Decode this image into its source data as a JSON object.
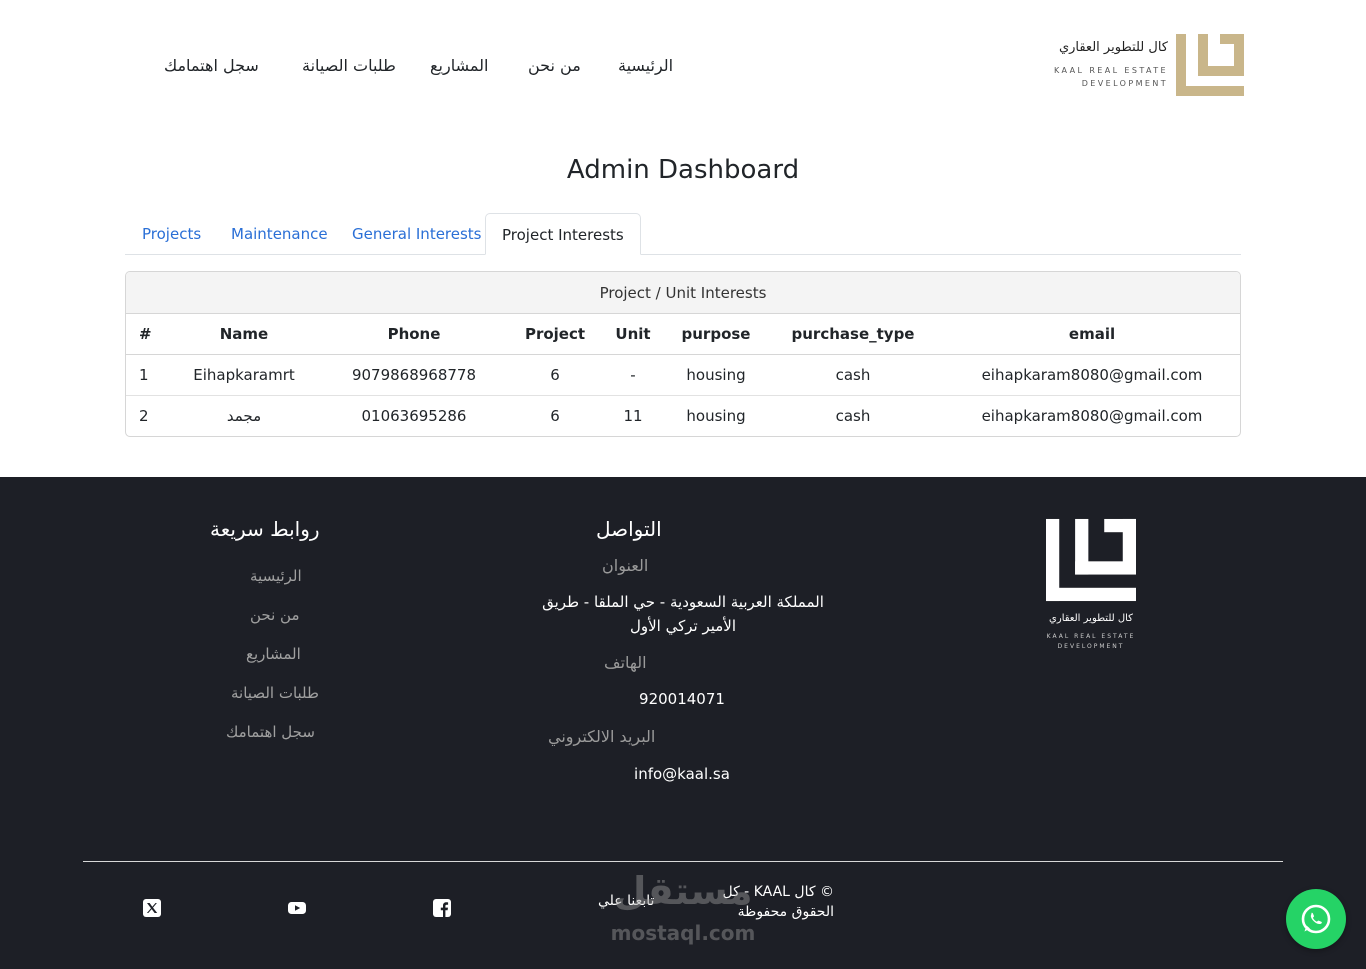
{
  "brand": {
    "name_ar": "كال للتطوير العقاري",
    "name_en_line1": "KAAL REAL ESTATE",
    "name_en_line2": "DEVELOPMENT",
    "gold": "#c9b68a"
  },
  "nav": {
    "home": "الرئيسية",
    "about": "من نحن",
    "projects": "المشاريع",
    "maintenance": "طلبات الصيانة",
    "register_interest": "سجل اهتمامك"
  },
  "main": {
    "title": "Admin Dashboard",
    "tabs": [
      "Projects",
      "Maintenance",
      "General Interests",
      "Project Interests"
    ],
    "active_tab": "Project Interests",
    "card_title": "Project / Unit Interests",
    "columns": [
      "#",
      "Name",
      "Phone",
      "Project",
      "Unit",
      "purpose",
      "purchase_type",
      "email"
    ],
    "rows": [
      [
        "1",
        "Eihapkaramrt",
        "9079868968778",
        "6",
        "-",
        "housing",
        "cash",
        "eihapkaram8080@gmail.com"
      ],
      [
        "2",
        "مجمد",
        "01063695286",
        "6",
        "11",
        "housing",
        "cash",
        "eihapkaram8080@gmail.com"
      ]
    ]
  },
  "footer": {
    "quick_links_title": "روابط سريعة",
    "quick_links": [
      "الرئيسية",
      "من نحن",
      "المشاريع",
      "طلبات الصيانة",
      "سجل اهتمامك"
    ],
    "contact_title": "التواصل",
    "address_label": "العنوان",
    "address": "المملكة العربية السعودية - حي الملقا - طريق الأمير تركي الأول",
    "phone_label": "الهاتف",
    "phone": "920014071",
    "email_label": "البريد الالكتروني",
    "email": "info@kaal.sa",
    "copyright": "© كال KAAL - كل الحقوق محفوظة",
    "follow_us": "تابعنا علي",
    "social_icons": [
      "facebook-icon",
      "youtube-icon",
      "x-twitter-icon"
    ],
    "background": "#1d1f26"
  },
  "watermark": {
    "arabic": "مستقل",
    "latin": "mostaql.com"
  },
  "whatsapp": {
    "icon": "whatsapp-icon",
    "color": "#25d366"
  }
}
